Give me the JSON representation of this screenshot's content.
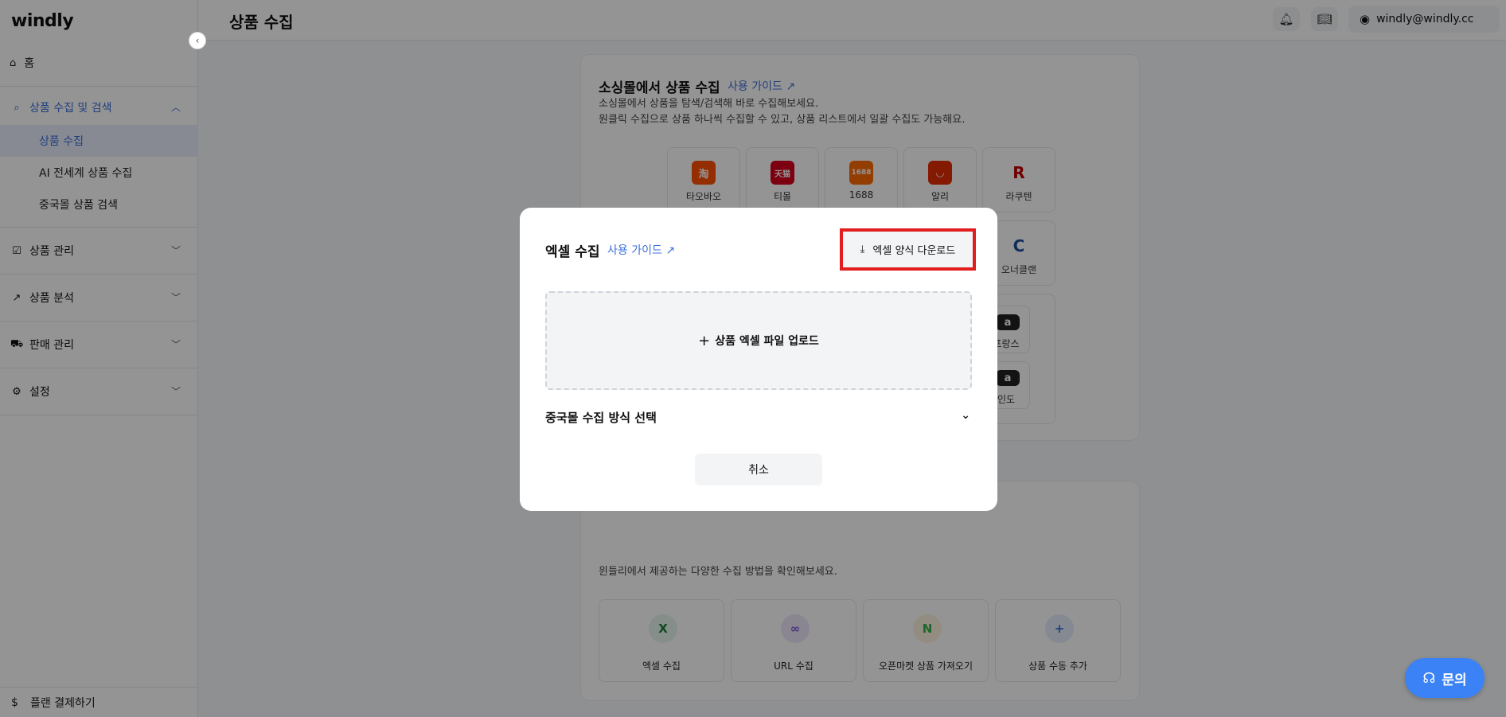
{
  "brand": {
    "logo": "windly"
  },
  "sidebar": {
    "home_label": "홈",
    "groups": [
      {
        "label": "상품 수집 및 검색",
        "expanded": true,
        "items": [
          {
            "label": "상품 수집",
            "active": true
          },
          {
            "label": "AI 전세계 상품 수집",
            "active": false
          },
          {
            "label": "중국몰 상품 검색",
            "active": false
          }
        ]
      },
      {
        "label": "상품 관리",
        "expanded": false
      },
      {
        "label": "상품 분석",
        "expanded": false
      },
      {
        "label": "판매 관리",
        "expanded": false
      },
      {
        "label": "설정",
        "expanded": false
      }
    ],
    "bottom_label": "플랜 결제하기"
  },
  "header": {
    "title": "상품 수집",
    "user_email": "windly@windly.cc"
  },
  "sourcing_card": {
    "title": "소싱몰에서 상품 수집",
    "guide_label": "사용 가이드",
    "desc_line1": "소싱몰에서 상품을 탐색/검색해 바로 수집해보세요.",
    "desc_line2": "원클릭 수집으로 상품 하나씩 수집할 수 있고, 상품 리스트에서 일괄 수집도 가능해요.",
    "malls": [
      {
        "name": "타오바오",
        "glyph": "淘",
        "color": "#ff5000"
      },
      {
        "name": "티몰",
        "glyph": "天猫",
        "color": "#d6001c"
      },
      {
        "name": "1688",
        "glyph": "1688",
        "color": "#ff6a00"
      },
      {
        "name": "알리",
        "glyph": "◡",
        "color": "#e62e04"
      },
      {
        "name": "라쿠텐",
        "glyph": "R",
        "color": "#bf0000"
      }
    ],
    "side_malls": [
      {
        "name": "오너클랜",
        "glyph": "C",
        "color": "#1f4f9e"
      },
      {
        "name": "프랑스",
        "glyph": "a",
        "color": "#222222"
      },
      {
        "name": "인도",
        "glyph": "a",
        "color": "#222222"
      }
    ]
  },
  "other_card": {
    "desc": "윈들리에서 제공하는 다양한 수집 방법을 확인해보세요.",
    "methods": [
      {
        "name": "엑셀 수집",
        "glyph": "X",
        "bg": "#e6f4ea",
        "fg": "#1d7a3a"
      },
      {
        "name": "URL 수집",
        "glyph": "∞",
        "bg": "#ede7fb",
        "fg": "#7c5cd6"
      },
      {
        "name": "오픈마켓 상품 가져오기",
        "glyph": "N",
        "bg": "#fdf1dc",
        "fg": "#2db34a"
      },
      {
        "name": "상품 수동 추가",
        "glyph": "+",
        "bg": "#e3ecfb",
        "fg": "#3b6fd8"
      }
    ]
  },
  "modal": {
    "title": "엑셀 수집",
    "guide_label": "사용 가이드",
    "download_label": "엑셀 양식 다운로드",
    "upload_label": "상품 엑셀 파일 업로드",
    "select_label": "중국몰 수집 방식 선택",
    "cancel_label": "취소"
  },
  "chat": {
    "label": "문의"
  },
  "colors": {
    "accent": "#3b6fd8",
    "highlight": "#e11d1d",
    "chat": "#3b82f6"
  }
}
